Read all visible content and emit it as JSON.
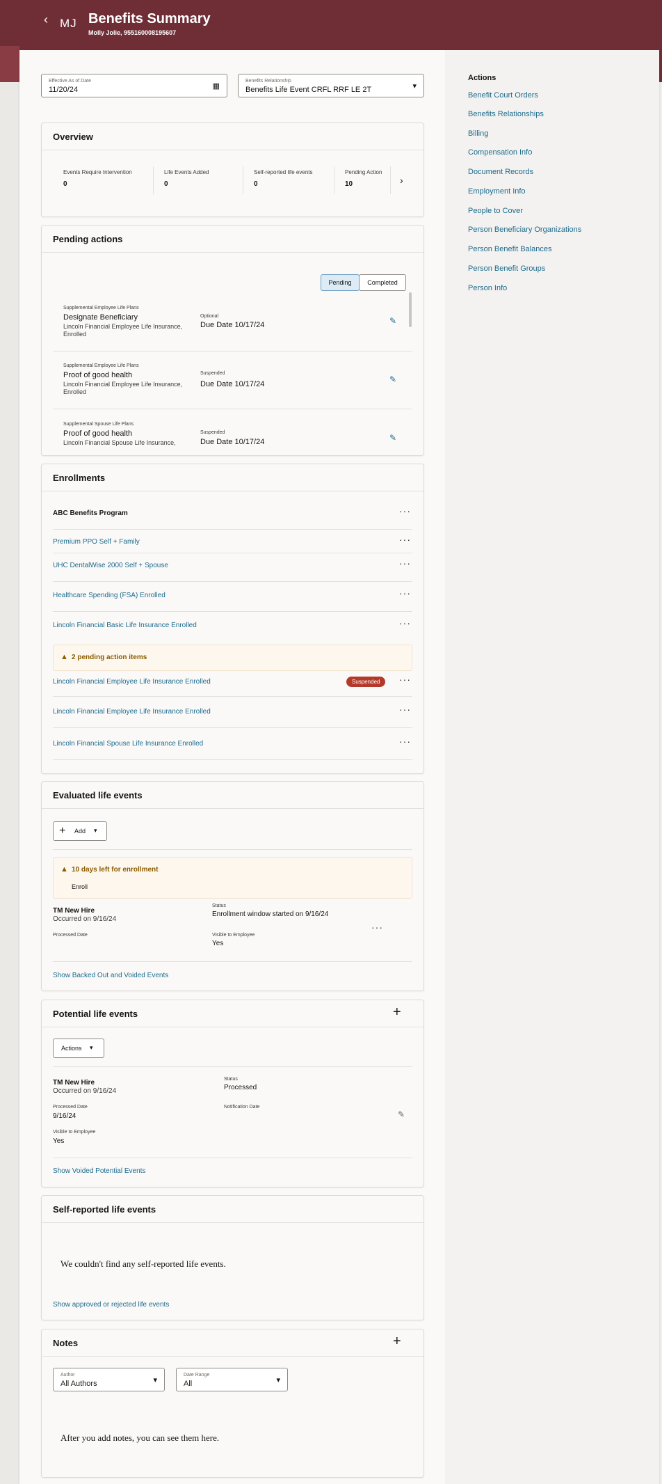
{
  "header": {
    "title": "Benefits Summary",
    "subtitle": "Molly Jolie, 955160008195607",
    "initials": "MJ",
    "back_icon": "‹"
  },
  "filters": {
    "effective_date": {
      "label": "Effective As of Date",
      "value": "11/20/24"
    },
    "relationship": {
      "label": "Benefits Relationship",
      "value": "Benefits Life Event CRFL RRF LE 2T"
    }
  },
  "actions": {
    "title": "Actions",
    "items": [
      "Benefit Court Orders",
      "Benefits Relationships",
      "Billing",
      "Compensation Info",
      "Document Records",
      "Employment Info",
      "People to Cover",
      "Person Beneficiary Organizations",
      "Person Benefit Balances",
      "Person Benefit Groups",
      "Person Info"
    ]
  },
  "overview": {
    "title": "Overview",
    "metrics": [
      {
        "label": "Events Require Intervention",
        "value": "0"
      },
      {
        "label": "Life Events Added",
        "value": "0"
      },
      {
        "label": "Self-reported life events",
        "value": "0"
      },
      {
        "label": "Pending Action",
        "value": "10"
      }
    ]
  },
  "pending": {
    "title": "Pending actions",
    "toggle": [
      "Pending",
      "Completed"
    ],
    "items": [
      {
        "category": "Supplemental Employee Life Plans",
        "name": "Designate Beneficiary",
        "detail": "Lincoln Financial Employee Life Insurance,",
        "detail2": "Enrolled",
        "status": "Optional",
        "due": "Due Date 10/17/24"
      },
      {
        "category": "Supplemental Employee Life Plans",
        "name": "Proof of good health",
        "detail": "Lincoln Financial Employee Life Insurance,",
        "detail2": "Enrolled",
        "status": "Suspended",
        "due": "Due Date 10/17/24"
      },
      {
        "category": "Supplemental Spouse Life Plans",
        "name": "Proof of good health",
        "detail": "Lincoln Financial Spouse Life Insurance,",
        "detail2": "",
        "status": "Suspended",
        "due": "Due Date 10/17/24"
      }
    ]
  },
  "enrollments": {
    "title": "Enrollments",
    "program": "ABC Benefits Program",
    "items": [
      "Premium PPO Self + Family",
      "UHC DentalWise 2000 Self + Spouse",
      "Healthcare Spending (FSA) Enrolled",
      "Lincoln Financial Basic Life Insurance Enrolled"
    ],
    "warning": "2 pending action items",
    "items2": [
      "Lincoln Financial Employee Life Insurance Enrolled",
      "Lincoln Financial Employee Life Insurance Enrolled",
      "Lincoln Financial Spouse Life Insurance Enrolled"
    ],
    "badge": "Suspended"
  },
  "evaluated": {
    "title": "Evaluated life events",
    "add": "Add",
    "warning": "10 days left for enrollment",
    "enroll": "Enroll",
    "event": {
      "name": "TM New Hire",
      "occurred": "Occurred on 9/16/24",
      "status_label": "Status",
      "status": "Enrollment window started on 9/16/24",
      "processed_label": "Processed Date",
      "visible_label": "Visible to Employee",
      "visible": "Yes"
    },
    "link": "Show Backed Out and Voided Events"
  },
  "potential": {
    "title": "Potential life events",
    "actions": "Actions",
    "event": {
      "name": "TM New Hire",
      "occurred": "Occurred on 9/16/24",
      "status_label": "Status",
      "status": "Processed",
      "processed_label": "Processed Date",
      "processed": "9/16/24",
      "notif_label": "Notification Date",
      "visible_label": "Visible to Employee",
      "visible": "Yes"
    },
    "link": "Show Voided Potential Events"
  },
  "self_reported": {
    "title": "Self-reported life events",
    "empty": "We couldn't find any self-reported life events.",
    "link": "Show approved or rejected life events"
  },
  "notes": {
    "title": "Notes",
    "author": {
      "label": "Author",
      "value": "All Authors"
    },
    "range": {
      "label": "Date Range",
      "value": "All"
    },
    "empty": "After you add notes, you can see them here."
  },
  "colors": {
    "brand": "#6f2d36",
    "link": "#1c6b8d",
    "badge": "#b33a2a",
    "warning": "#8a5b00"
  }
}
